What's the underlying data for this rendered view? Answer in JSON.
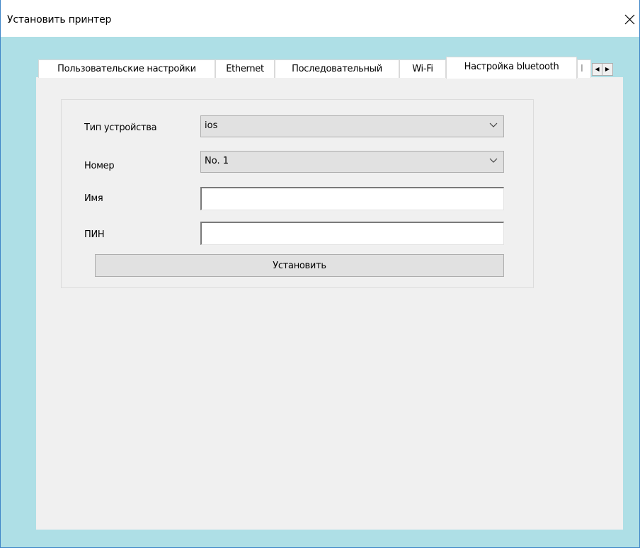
{
  "window": {
    "title": "Установить принтер"
  },
  "tabs": [
    {
      "label": "Пользовательские настройки",
      "active": false
    },
    {
      "label": "Ethernet",
      "active": false
    },
    {
      "label": "Последовательный",
      "active": false
    },
    {
      "label": "Wi-Fi",
      "active": false
    },
    {
      "label": "Настройка bluetooth",
      "active": true
    },
    {
      "label": "I",
      "active": false
    }
  ],
  "tab_scroll": {
    "left_icon": "scroll-left-arrow",
    "right_icon": "scroll-right-arrow"
  },
  "form": {
    "device_type_label": "Тип устройства",
    "device_type_value": "ios",
    "number_label": "Номер",
    "number_value": "No. 1",
    "name_label": "Имя",
    "name_value": "",
    "pin_label": "ПИН",
    "pin_value": "",
    "submit_label": "Установить"
  },
  "colors": {
    "window_frame": "#aedfe6",
    "panel": "#f0f0f0",
    "button": "#e1e1e1",
    "border_accent": "#3f86c8"
  }
}
